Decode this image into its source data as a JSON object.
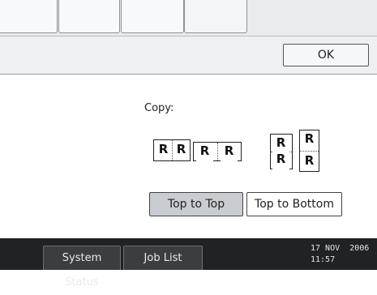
{
  "header": {
    "ok_label": "OK"
  },
  "content": {
    "copy_label": "Copy:",
    "icons": {
      "side_by_side_letter": "R",
      "stacked_letter": "R"
    }
  },
  "orientation": {
    "options": [
      "Top to Top",
      "Top to Bottom"
    ],
    "selected": "Top to Top"
  },
  "status_bar": {
    "system_status_label": "System Status",
    "job_list_label": "Job List",
    "date": "17 NOV  2006",
    "time": "11:57"
  },
  "colors": {
    "status_bar_bg": "#202224",
    "selected_toggle_bg": "#c9cdd1"
  }
}
